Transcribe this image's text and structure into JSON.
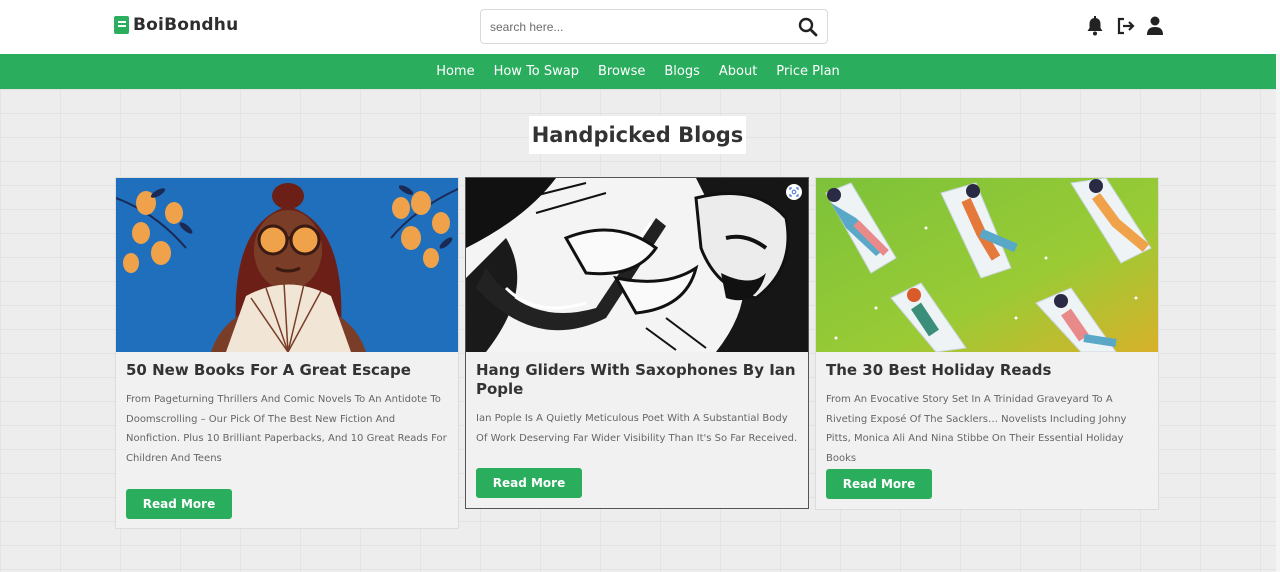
{
  "header": {
    "brand": "BoiBondhu",
    "search": {
      "placeholder": "search here...",
      "value": ""
    },
    "icons": [
      "bell-icon",
      "logout-icon",
      "user-icon"
    ]
  },
  "nav": {
    "items": [
      {
        "label": "Home"
      },
      {
        "label": "How To Swap"
      },
      {
        "label": "Browse"
      },
      {
        "label": "Blogs"
      },
      {
        "label": "About"
      },
      {
        "label": "Price Plan"
      }
    ]
  },
  "section": {
    "title": "Handpicked Blogs"
  },
  "cards": [
    {
      "title": "50 New Books For A Great Escape",
      "description": "From Pageturning Thrillers And Comic Novels To An Antidote To Doomscrolling – Our Pick Of The Best New Fiction And Nonfiction. Plus 10 Brilliant Paperbacks, And 10 Great Reads For Children And Teens",
      "button": "Read More"
    },
    {
      "title": "Hang Gliders With Saxophones By Ian Pople",
      "description": "Ian Pople Is A Quietly Meticulous Poet With A Substantial Body Of Work Deserving Far Wider Visibility Than It's So Far Received.",
      "button": "Read More"
    },
    {
      "title": "The 30 Best Holiday Reads",
      "description": "From An Evocative Story Set In A Trinidad Graveyard To A Riveting Exposé Of The Sacklers… Novelists Including Johny Pitts, Monica Ali And Nina Stibbe On Their Essential Holiday Books",
      "button": "Read More"
    }
  ],
  "colors": {
    "accent": "#2aae5e",
    "background": "#ececec",
    "text": "#333333"
  }
}
